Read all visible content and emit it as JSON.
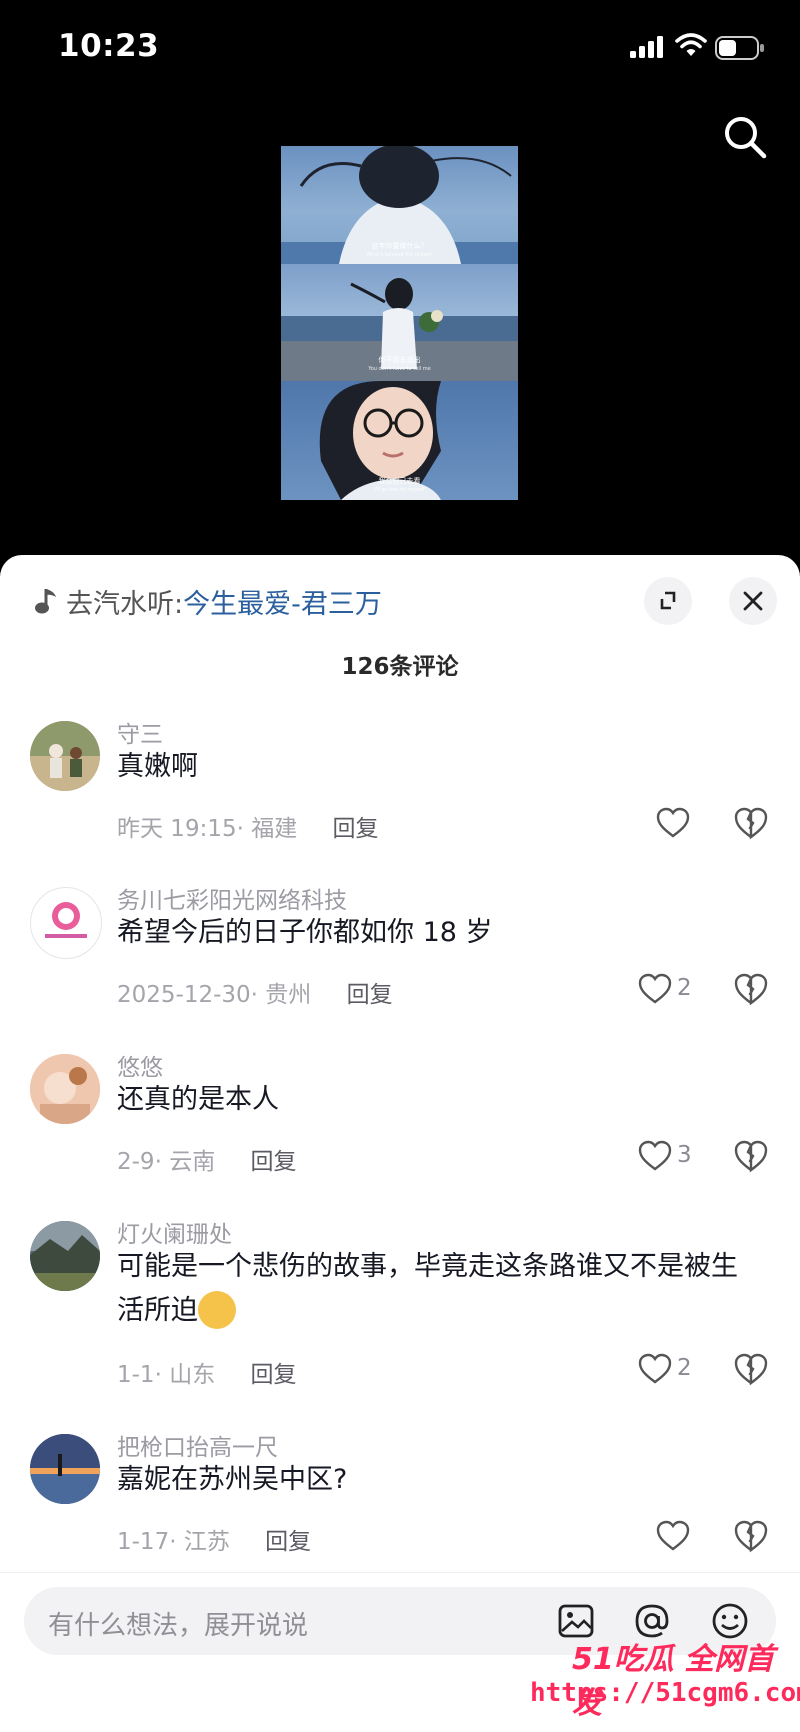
{
  "status_bar": {
    "time": "10:23"
  },
  "video": {
    "captions": [
      {
        "cn": "这年你要做什么？",
        "en": "What's beyond the ocean?"
      },
      {
        "cn": "你不用去说出",
        "en": "You don't have to tell me"
      },
      {
        "cn": "我会自己去看",
        "en": "I'll go see for myself"
      }
    ]
  },
  "sheet": {
    "music_prefix": "去汽水听:",
    "music_title": "今生最爱-君三万",
    "comment_count": "126条评论",
    "comments": [
      {
        "user": "守三",
        "text": "真嫩啊",
        "time": "昨天 19:15",
        "location": "福建",
        "reply": "回复",
        "likes": ""
      },
      {
        "user": "务川七彩阳光网络科技",
        "text": "希望今后的日子你都如你 18 岁",
        "time": "2025-12-30",
        "location": "贵州",
        "reply": "回复",
        "likes": "2"
      },
      {
        "user": "悠悠",
        "text": "还真的是本人",
        "time": "2-9",
        "location": "云南",
        "reply": "回复",
        "likes": "3"
      },
      {
        "user": "灯火阑珊处",
        "text": "可能是一个悲伤的故事，毕竟走这条路谁又不是被生",
        "text2": "活所迫",
        "time": "1-1",
        "location": "山东",
        "reply": "回复",
        "likes": "2"
      },
      {
        "user": "把枪口抬高一尺",
        "text": "嘉妮在苏州吴中区?",
        "time": "1-17",
        "location": "江苏",
        "reply": "回复",
        "likes": ""
      }
    ],
    "input_placeholder": "有什么想法，展开说说"
  },
  "watermark": {
    "line1": "51吃瓜 全网首发",
    "line2": "https://51cgm6.com"
  },
  "colors": {
    "link": "#2b5f9e",
    "muted": "#9b9ba3",
    "watermark": "#ff2a5c"
  }
}
